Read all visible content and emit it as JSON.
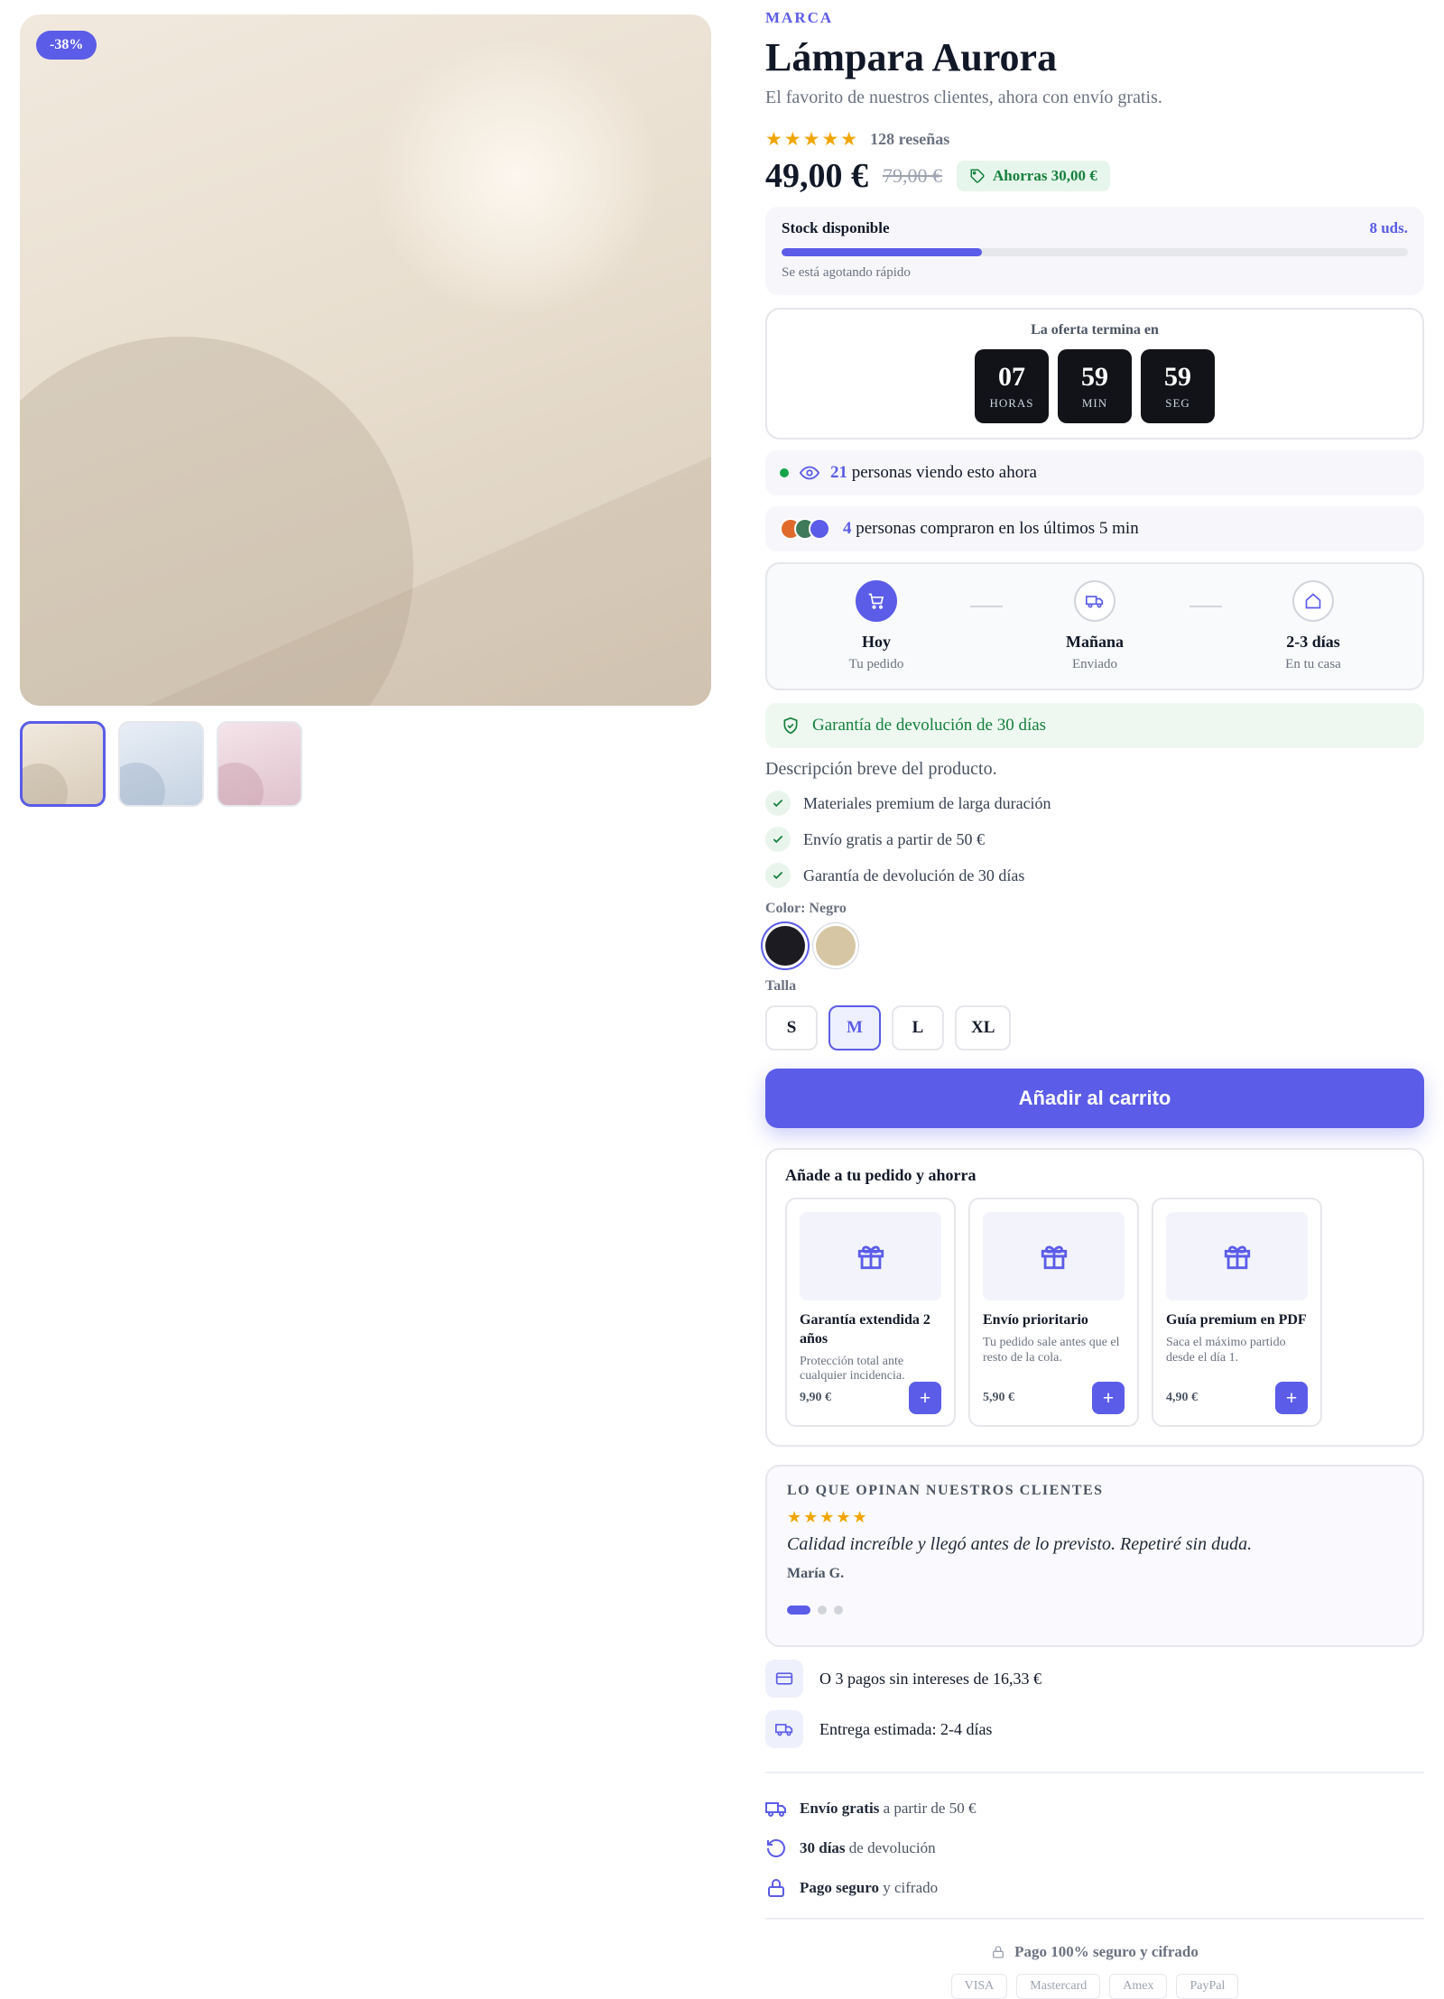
{
  "gallery": {
    "discount_badge": "-38%",
    "thumbnails": [
      "Beige",
      "Azul",
      "Rosa"
    ]
  },
  "product": {
    "brand": "MARCA",
    "title": "Lámpara Aurora",
    "subtitle": "El favorito de nuestros clientes, ahora con envío gratis.",
    "rating_stars": "★★★★★",
    "reviews_count": "128 reseñas",
    "price": "49,00 €",
    "old_price": "79,00 €",
    "savings": "Ahorras 30,00 €"
  },
  "stock": {
    "label": "Stock disponible",
    "units": "8 uds.",
    "level": 0.32,
    "hint": "Se está agotando rápido"
  },
  "countdown": {
    "label": "La oferta termina en",
    "hours": "07",
    "hours_label": "HORAS",
    "minutes": "59",
    "minutes_label": "MIN",
    "seconds": "59",
    "seconds_label": "SEG"
  },
  "social": {
    "viewers_count": "21",
    "viewers_text": "personas viendo esto ahora",
    "buyers_count": "4",
    "buyers_text": "personas compraron en los últimos 5 min",
    "avatar_colors": [
      "#e06a2b",
      "#3f7a5a",
      "#5b5ce8"
    ]
  },
  "delivery_steps": [
    {
      "title": "Hoy",
      "sub": "Tu pedido"
    },
    {
      "title": "Mañana",
      "sub": "Enviado"
    },
    {
      "title": "2-3 días",
      "sub": "En tu casa"
    }
  ],
  "guarantee": "Garantía de devolución de 30 días",
  "description": "Descripción breve del producto.",
  "features": [
    "Materiales premium de larga duración",
    "Envío gratis a partir de 50 €",
    "Garantía de devolución de 30 días"
  ],
  "color": {
    "label": "Color: Negro",
    "options": [
      "#1c1b22",
      "#d6c6a4"
    ]
  },
  "size": {
    "label": "Talla",
    "options": [
      "S",
      "M",
      "L",
      "XL"
    ],
    "selected": "M"
  },
  "cta": "Añadir al carrito",
  "upsell": {
    "title": "Añade a tu pedido y ahorra",
    "items": [
      {
        "name": "Garantía extendida 2 años",
        "desc": "Protección total ante cualquier incidencia.",
        "price": "9,90 €",
        "add": "+"
      },
      {
        "name": "Envío prioritario",
        "desc": "Tu pedido sale antes que el resto de la cola.",
        "price": "5,90 €",
        "add": "+"
      },
      {
        "name": "Guía premium en PDF",
        "desc": "Saca el máximo partido desde el día 1.",
        "price": "4,90 €",
        "add": "+"
      }
    ]
  },
  "review": {
    "heading": "LO QUE OPINAN NUESTROS CLIENTES",
    "stars": "★★★★★",
    "quote": "Calidad increíble y llegó antes de lo previsto. Repetiré sin duda.",
    "author": "María G."
  },
  "payment_info": {
    "installments": "O 3 pagos sin intereses de 16,33 €",
    "delivery": "Entrega estimada: 2-4 días"
  },
  "trust": {
    "shipping_bold": "Envío gratis",
    "shipping_rest": "a partir de 50 €",
    "returns_bold": "30 días",
    "returns_rest": "de devolución",
    "secure_bold": "Pago seguro",
    "secure_rest": "y cifrado"
  },
  "secure_line": "Pago 100% seguro y cifrado",
  "payment_methods": [
    "VISA",
    "Mastercard",
    "Amex",
    "PayPal"
  ],
  "colors": {
    "accent": "#5b5ce8",
    "success": "#15803d",
    "star": "#f0a500",
    "dark": "#111318"
  }
}
